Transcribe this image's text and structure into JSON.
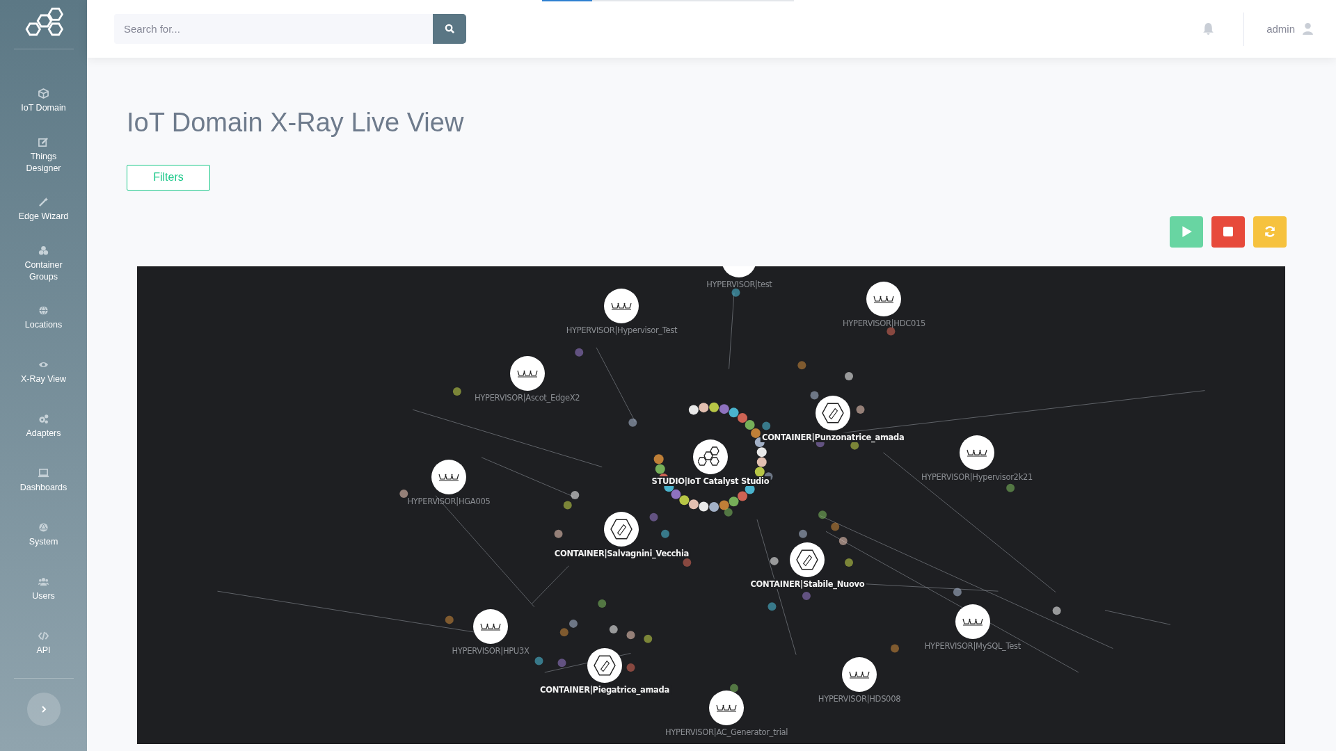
{
  "sidebar": {
    "items": [
      {
        "label": "IoT Domain",
        "selected": false
      },
      {
        "label": "Things Designer",
        "selected": false
      },
      {
        "label": "Edge Wizard",
        "selected": false
      },
      {
        "label": "Container Groups",
        "selected": false
      },
      {
        "label": "Locations",
        "selected": false
      },
      {
        "label": "X-Ray View",
        "selected": false
      },
      {
        "label": "Adapters",
        "selected": false
      },
      {
        "label": "Dashboards",
        "selected": false
      },
      {
        "label": "System",
        "selected": false
      },
      {
        "label": "Users",
        "selected": false
      },
      {
        "label": "API",
        "selected": false
      }
    ]
  },
  "progress": {
    "level": 0.2
  },
  "header": {
    "search": {
      "placeholder": "Search for..."
    },
    "user": "admin"
  },
  "page": {
    "title": "IoT Domain X-Ray Live View",
    "filters_button": "Filters"
  },
  "graph": {
    "nodes": [
      {
        "kind": "hypervisor",
        "label": "HYPERVISOR|test"
      },
      {
        "kind": "hypervisor",
        "label": "HYPERVISOR|Hypervisor_Test"
      },
      {
        "kind": "hypervisor",
        "label": "HYPERVISOR|HDC015"
      },
      {
        "kind": "hypervisor",
        "label": "HYPERVISOR|Ascot_EdgeX2"
      },
      {
        "kind": "container",
        "label": "CONTAINER|Punzonatrice_amada"
      },
      {
        "kind": "studio",
        "label": "STUDIO|IoT Catalyst Studio"
      },
      {
        "kind": "hypervisor",
        "label": "HYPERVISOR|Hypervisor2k21"
      },
      {
        "kind": "hypervisor",
        "label": "HYPERVISOR|HGA005"
      },
      {
        "kind": "container",
        "label": "CONTAINER|Salvagnini_Vecchia"
      },
      {
        "kind": "container",
        "label": "CONTAINER|Stabile_Nuovo"
      },
      {
        "kind": "hypervisor",
        "label": "HYPERVISOR|HPU3X"
      },
      {
        "kind": "hypervisor",
        "label": "HYPERVISOR|MySQL_Test"
      },
      {
        "kind": "hypervisor",
        "label": "HYPERVISOR|HDS008"
      },
      {
        "kind": "container",
        "label": "CONTAINER|Piegatrice_amada"
      },
      {
        "kind": "hypervisor",
        "label": "HYPERVISOR|AC_Generator_trial"
      }
    ]
  }
}
